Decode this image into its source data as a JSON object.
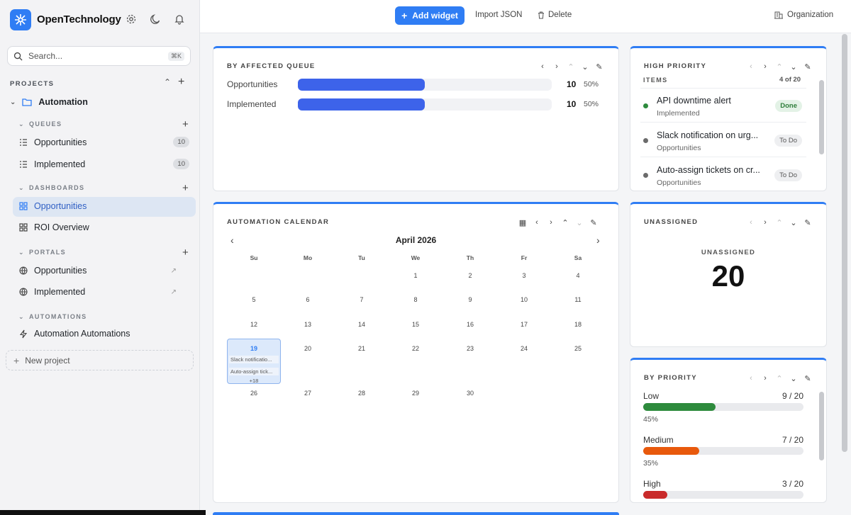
{
  "app": {
    "title": "OpenTechnology"
  },
  "sidebar": {
    "search_placeholder": "Search...",
    "search_shortcut": "⌘K",
    "projects_label": "PROJECTS",
    "project_name": "Automation",
    "queues_label": "QUEUES",
    "queues": [
      {
        "label": "Opportunities",
        "count": "10"
      },
      {
        "label": "Implemented",
        "count": "10"
      }
    ],
    "dashboards_label": "DASHBOARDS",
    "dashboards": [
      {
        "label": "Opportunities"
      },
      {
        "label": "ROI Overview"
      }
    ],
    "portals_label": "PORTALS",
    "portals": [
      {
        "label": "Opportunities"
      },
      {
        "label": "Implemented"
      }
    ],
    "automations_label": "AUTOMATIONS",
    "automations": [
      {
        "label": "Automation Automations"
      }
    ],
    "new_project": "New project"
  },
  "topbar": {
    "add_widget": "Add widget",
    "import_json": "Import JSON",
    "delete": "Delete",
    "organization": "Organization"
  },
  "widgets": {
    "queue": {
      "title": "BY AFFECTED QUEUE",
      "rows": [
        {
          "label": "Opportunities",
          "value": "10",
          "pct": "50%",
          "fraction": 0.5
        },
        {
          "label": "Implemented",
          "value": "10",
          "pct": "50%",
          "fraction": 0.5
        }
      ]
    },
    "high_priority": {
      "title": "HIGH PRIORITY",
      "items_label": "ITEMS",
      "range": "4 of 20",
      "items": [
        {
          "title": "API downtime alert",
          "status": "Implemented",
          "badge": "Done",
          "dot": "#2e8b3d"
        },
        {
          "title": "Slack notification on urg...",
          "status": "Opportunities",
          "badge": "To Do",
          "dot": "#6b6b6b"
        },
        {
          "title": "Auto-assign tickets on cr...",
          "status": "Opportunities",
          "badge": "To Do",
          "dot": "#6b6b6b"
        }
      ]
    },
    "calendar": {
      "title": "AUTOMATION CALENDAR",
      "month": "April 2026",
      "weekdays": [
        "Su",
        "Mo",
        "Tu",
        "We",
        "Th",
        "Fr",
        "Sa"
      ],
      "days": [
        "1",
        "2",
        "3",
        "4",
        "5",
        "6",
        "7",
        "8",
        "9",
        "10",
        "11",
        "12",
        "13",
        "14",
        "15",
        "16",
        "17",
        "18",
        "19",
        "20",
        "21",
        "22",
        "23",
        "24",
        "25",
        "26",
        "27",
        "28",
        "29",
        "30"
      ],
      "today": {
        "day": "19",
        "events": [
          "Slack notificatio...",
          "Auto-assign tick..."
        ],
        "more": "+18"
      }
    },
    "unassigned": {
      "title": "UNASSIGNED",
      "label": "UNASSIGNED",
      "value": "20"
    },
    "by_priority": {
      "title": "BY PRIORITY",
      "rows": [
        {
          "label": "Low",
          "value": "9 / 20",
          "pct": "45%",
          "fraction": 0.45,
          "color": "#2e8b3d"
        },
        {
          "label": "Medium",
          "value": "7 / 20",
          "pct": "35%",
          "fraction": 0.35,
          "color": "#e8590c"
        },
        {
          "label": "High",
          "value": "3 / 20",
          "pct": "",
          "fraction": 0.15,
          "color": "#c92a2a"
        }
      ]
    }
  }
}
